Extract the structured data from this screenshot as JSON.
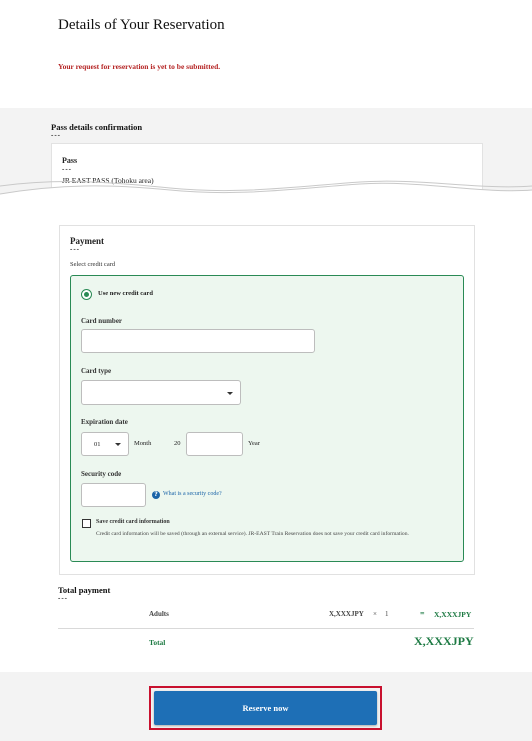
{
  "page": {
    "title": "Details of Your Reservation",
    "warning": "Your request for reservation is yet to be submitted."
  },
  "pass_section": {
    "heading": "Pass details confirmation",
    "pass_label": "Pass",
    "pass_value": "JR EAST PASS (Tohoku area)"
  },
  "payment": {
    "heading": "Payment",
    "select_label": "Select credit card",
    "use_new_card_label": "Use new credit card",
    "card_number_label": "Card number",
    "card_number_value": "",
    "card_type_label": "Card type",
    "card_type_value": "",
    "expiration_label": "Expiration date",
    "month_value": "01",
    "month_label": "Month",
    "year_prefix": "20",
    "year_value": "",
    "year_label": "Year",
    "security_code_label": "Security code",
    "security_code_value": "",
    "help_icon_glyph": "?",
    "security_help_link": "What is a security code?",
    "save_card_label": "Save credit card information",
    "save_card_note": "Credit card information will be saved (through an external service). JR-EAST Train Reservation does not save your credit card information."
  },
  "total": {
    "heading": "Total payment",
    "adults_label": "Adults",
    "unit_price": "X,XXXJPY",
    "times": "×",
    "quantity": "1",
    "equals": "=",
    "line_amount": "X,XXXJPY",
    "total_label": "Total",
    "total_amount": "X,XXXJPY"
  },
  "actions": {
    "reserve_label": "Reserve now"
  },
  "decor": {
    "dashes": "---"
  },
  "colors": {
    "accent_green": "#2a8a55",
    "warning_red": "#b52424",
    "button_blue": "#1e6fb6",
    "highlight_red": "#c8102e"
  }
}
